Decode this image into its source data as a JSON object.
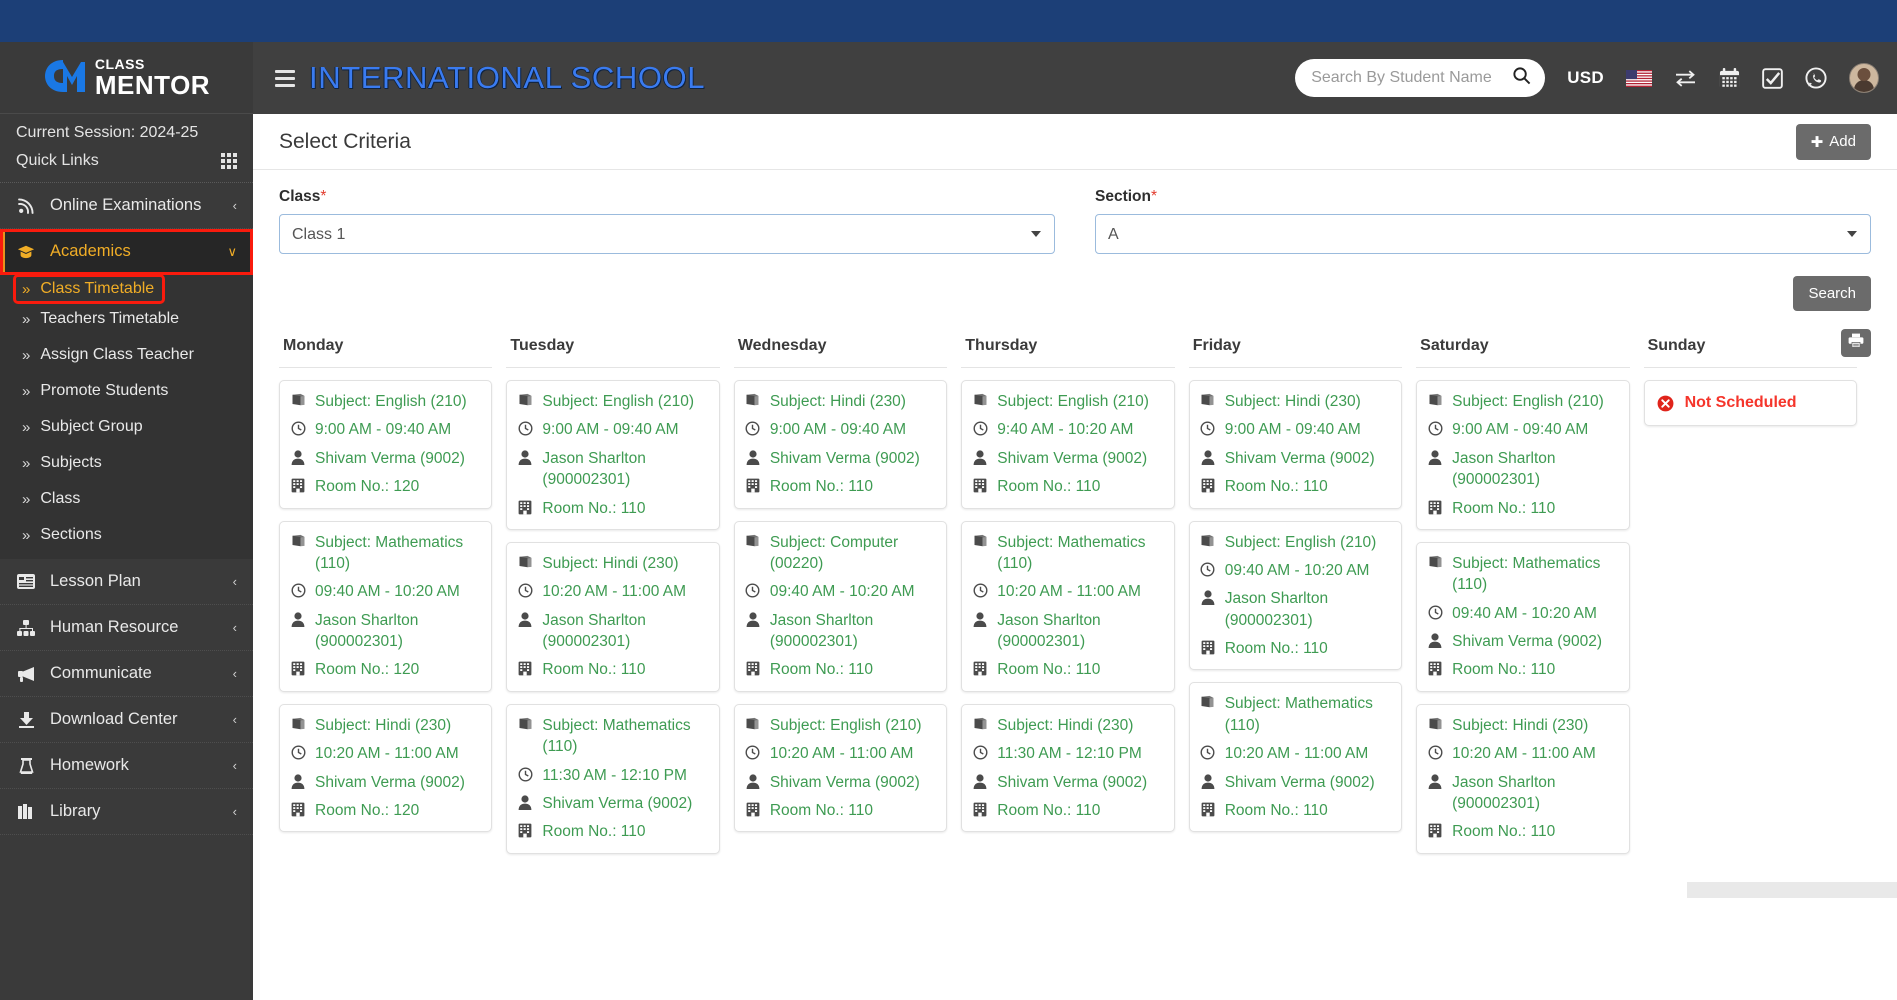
{
  "brand": {
    "line1": "CLASS",
    "line2": "MENTOR"
  },
  "sidebar": {
    "session": "Current Session: 2024-25",
    "quick_links": "Quick Links",
    "items": [
      {
        "label": "Online Examinations",
        "icon": "rss-icon",
        "caret": "‹"
      },
      {
        "label": "Academics",
        "icon": "graduation-cap-icon",
        "caret": "∨",
        "active": true
      },
      {
        "label": "Lesson Plan",
        "icon": "lesson-plan-icon",
        "caret": "‹"
      },
      {
        "label": "Human Resource",
        "icon": "sitemap-icon",
        "caret": "‹"
      },
      {
        "label": "Communicate",
        "icon": "megaphone-icon",
        "caret": "‹"
      },
      {
        "label": "Download Center",
        "icon": "download-icon",
        "caret": "‹"
      },
      {
        "label": "Homework",
        "icon": "homework-icon",
        "caret": "‹"
      },
      {
        "label": "Library",
        "icon": "library-icon",
        "caret": "‹"
      }
    ],
    "submenu": [
      {
        "label": "Class Timetable",
        "highlighted": true
      },
      {
        "label": "Teachers Timetable"
      },
      {
        "label": "Assign Class Teacher"
      },
      {
        "label": "Promote Students"
      },
      {
        "label": "Subject Group"
      },
      {
        "label": "Subjects"
      },
      {
        "label": "Class"
      },
      {
        "label": "Sections"
      }
    ]
  },
  "header": {
    "school_title": "INTERNATIONAL SCHOOL",
    "search_placeholder": "Search By Student Name",
    "search_value": "",
    "currency": "USD",
    "icons": [
      "flag-icon",
      "exchange-icon",
      "calendar-icon",
      "checkbox-icon",
      "whatsapp-icon",
      "avatar"
    ]
  },
  "panel": {
    "title": "Select Criteria",
    "add_label": "Add",
    "search_label": "Search",
    "class_label": "Class",
    "section_label": "Section",
    "required_mark": "*",
    "class_value": "Class 1",
    "section_value": "A",
    "class_options": [
      "Class 1"
    ],
    "section_options": [
      "A"
    ]
  },
  "timetable": {
    "not_scheduled_label": "Not Scheduled",
    "days": [
      {
        "name": "Monday",
        "entries": [
          {
            "subject": "Subject: English (210)",
            "time": "9:00 AM - 09:40 AM",
            "teacher": "Shivam Verma (9002)",
            "room": "Room No.: 120"
          },
          {
            "subject": "Subject: Mathematics (110)",
            "time": "09:40 AM - 10:20 AM",
            "teacher": "Jason Sharlton (900002301)",
            "room": "Room No.: 120"
          },
          {
            "subject": "Subject: Hindi (230)",
            "time": "10:20 AM - 11:00 AM",
            "teacher": "Shivam Verma (9002)",
            "room": "Room No.: 120"
          }
        ]
      },
      {
        "name": "Tuesday",
        "entries": [
          {
            "subject": "Subject: English (210)",
            "time": "9:00 AM - 09:40 AM",
            "teacher": "Jason Sharlton (900002301)",
            "room": "Room No.: 110"
          },
          {
            "subject": "Subject: Hindi (230)",
            "time": "10:20 AM - 11:00 AM",
            "teacher": "Jason Sharlton (900002301)",
            "room": "Room No.: 110"
          },
          {
            "subject": "Subject: Mathematics (110)",
            "time": "11:30 AM - 12:10 PM",
            "teacher": "Shivam Verma (9002)",
            "room": "Room No.: 110"
          }
        ]
      },
      {
        "name": "Wednesday",
        "entries": [
          {
            "subject": "Subject: Hindi (230)",
            "time": "9:00 AM - 09:40 AM",
            "teacher": "Shivam Verma (9002)",
            "room": "Room No.: 110"
          },
          {
            "subject": "Subject: Computer (00220)",
            "time": "09:40 AM - 10:20 AM",
            "teacher": "Jason Sharlton (900002301)",
            "room": "Room No.: 110"
          },
          {
            "subject": "Subject: English (210)",
            "time": "10:20 AM - 11:00 AM",
            "teacher": "Shivam Verma (9002)",
            "room": "Room No.: 110"
          }
        ]
      },
      {
        "name": "Thursday",
        "entries": [
          {
            "subject": "Subject: English (210)",
            "time": "9:40 AM - 10:20 AM",
            "teacher": "Shivam Verma (9002)",
            "room": "Room No.: 110"
          },
          {
            "subject": "Subject: Mathematics (110)",
            "time": "10:20 AM - 11:00 AM",
            "teacher": "Jason Sharlton (900002301)",
            "room": "Room No.: 110"
          },
          {
            "subject": "Subject: Hindi (230)",
            "time": "11:30 AM - 12:10 PM",
            "teacher": "Shivam Verma (9002)",
            "room": "Room No.: 110"
          }
        ]
      },
      {
        "name": "Friday",
        "entries": [
          {
            "subject": "Subject: Hindi (230)",
            "time": "9:00 AM - 09:40 AM",
            "teacher": "Shivam Verma (9002)",
            "room": "Room No.: 110"
          },
          {
            "subject": "Subject: English (210)",
            "time": "09:40 AM - 10:20 AM",
            "teacher": "Jason Sharlton (900002301)",
            "room": "Room No.: 110"
          },
          {
            "subject": "Subject: Mathematics (110)",
            "time": "10:20 AM - 11:00 AM",
            "teacher": "Shivam Verma (9002)",
            "room": "Room No.: 110"
          }
        ]
      },
      {
        "name": "Saturday",
        "entries": [
          {
            "subject": "Subject: English (210)",
            "time": "9:00 AM - 09:40 AM",
            "teacher": "Jason Sharlton (900002301)",
            "room": "Room No.: 110"
          },
          {
            "subject": "Subject: Mathematics (110)",
            "time": "09:40 AM - 10:20 AM",
            "teacher": "Shivam Verma (9002)",
            "room": "Room No.: 110"
          },
          {
            "subject": "Subject: Hindi (230)",
            "time": "10:20 AM - 11:00 AM",
            "teacher": "Jason Sharlton (900002301)",
            "room": "Room No.: 110"
          }
        ]
      },
      {
        "name": "Sunday",
        "entries": [],
        "not_scheduled": true
      }
    ]
  },
  "colors": {
    "accent_orange": "#f0ad26",
    "highlight_red": "#f91b0d",
    "entry_green": "#3e9b52",
    "not_scheduled_red": "#f5352b",
    "title_blue": "#3a7bf0",
    "topbar_blue": "#1c3f77"
  }
}
